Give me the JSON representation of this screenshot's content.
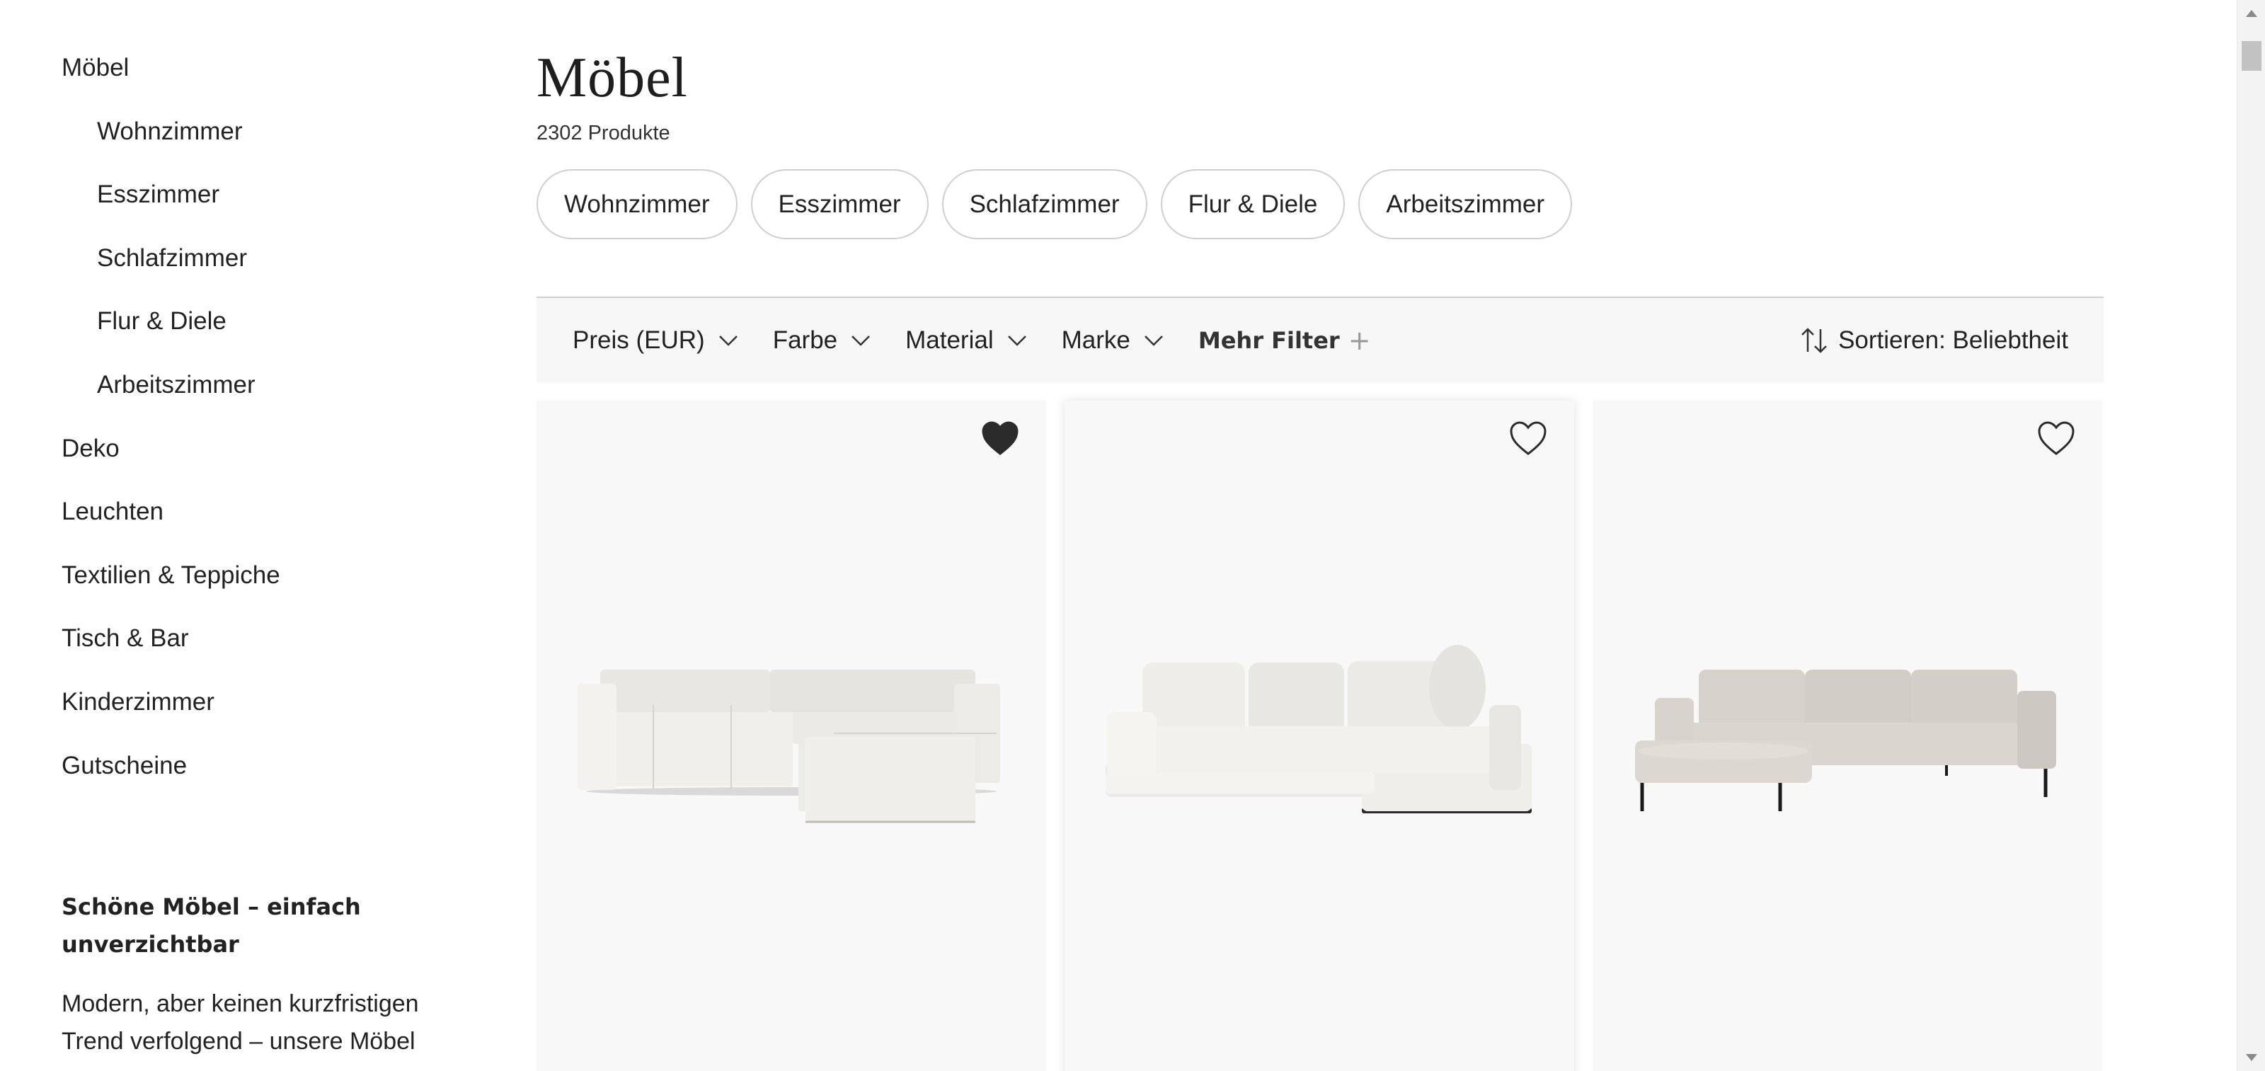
{
  "sidebar": {
    "items": [
      {
        "label": "Möbel",
        "level": "top"
      },
      {
        "label": "Wohnzimmer",
        "level": "sub"
      },
      {
        "label": "Esszimmer",
        "level": "sub"
      },
      {
        "label": "Schlafzimmer",
        "level": "sub"
      },
      {
        "label": "Flur & Diele",
        "level": "sub"
      },
      {
        "label": "Arbeitszimmer",
        "level": "sub"
      },
      {
        "label": "Deko",
        "level": "top"
      },
      {
        "label": "Leuchten",
        "level": "top"
      },
      {
        "label": "Textilien & Teppiche",
        "level": "top"
      },
      {
        "label": "Tisch & Bar",
        "level": "top"
      },
      {
        "label": "Kinderzimmer",
        "level": "top"
      },
      {
        "label": "Gutscheine",
        "level": "top"
      }
    ],
    "promo_title": "Schöne Möbel – einfach unverzichtbar",
    "promo_text": "Modern, aber keinen kurzfristigen Trend verfolgend – unsere Möbel"
  },
  "main": {
    "title": "Möbel",
    "product_count": "2302 Produkte",
    "chips": [
      "Wohnzimmer",
      "Esszimmer",
      "Schlafzimmer",
      "Flur & Diele",
      "Arbeitszimmer"
    ]
  },
  "filters": {
    "price": "Preis (EUR)",
    "color": "Farbe",
    "material": "Material",
    "brand": "Marke",
    "more": "Mehr Filter",
    "more_icon": "+",
    "sort": "Sortieren: Beliebtheit"
  },
  "products": [
    {
      "image": "modular-corner-sofa-cream",
      "favorited": true
    },
    {
      "image": "corner-sofa-cream-cushions",
      "favorited": false
    },
    {
      "image": "sofa-chaise-beige-metal-legs",
      "favorited": false
    }
  ],
  "icons": {
    "chevron": "chevron-down-icon",
    "heart_filled": "heart-filled-icon",
    "heart_outline": "heart-outline-icon",
    "sort": "sort-arrows-icon"
  },
  "colors": {
    "text": "#222222",
    "card_bg": "#f8f8f8",
    "filterbar_bg": "#f7f7f7",
    "chip_border": "#cfcfcf"
  }
}
